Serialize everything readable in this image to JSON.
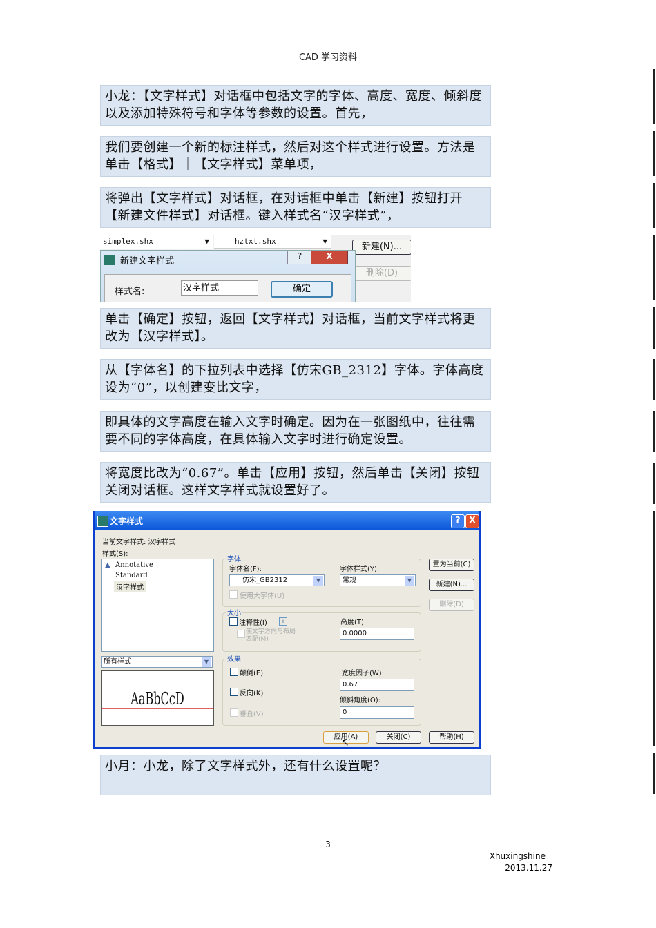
{
  "header": {
    "title": "CAD 学习资料"
  },
  "paragraphs": [
    "小龙：【文字样式】对话框中包括文字的字体、高度、宽度、倾斜度以及添加特殊符号和字体等参数的设置。首先，",
    "我们要创建一个新的标注样式，然后对这个样式进行设置。方法是单击【格式】｜【文字样式】菜单项，",
    "将弹出【文字样式】对话框，在对话框中单击【新建】按钮打开【新建文件样式】对话框。键入样式名“汉字样式”，",
    "单击【确定】按钮，返回【文字样式】对话框，当前文字样式将更改为【汉字样式】。",
    "从【字体名】的下拉列表中选择【仿宋GB_2312】字体。字体高度设为“0”，以创建变比文字，",
    "即具体的文字高度在输入文字时确定。因为在一张图纸中，往往需要不同的字体高度，在具体输入文字时进行确定设置。",
    "将宽度比改为“0.67”。单击【应用】按钮，然后单击【关闭】按钮关闭对话框。这样文字样式就设置好了。",
    "小月：小龙，除了文字样式外，还有什么设置呢？"
  ],
  "new_style_dialog": {
    "font_combo": "simplex.shx",
    "bigfont_combo": "hztxt.shx",
    "new_btn": "新建(N)...",
    "delete_btn": "删除(D)",
    "title": "新建文字样式",
    "help": "?",
    "close": "X",
    "name_label": "样式名:",
    "name_value": "汉字样式",
    "ok": "确定"
  },
  "text_style_dialog": {
    "title": "文字样式",
    "help": "?",
    "close": "X",
    "current_label": "当前文字样式:  汉字样式",
    "styles_label": "样式(S):",
    "styles": [
      "Annotative",
      "Standard",
      "汉字样式"
    ],
    "filter": "所有样式",
    "preview": "AaBbCcD",
    "font_group": "字体",
    "font_name_label": "字体名(F):",
    "font_name": "仿宋_GB2312",
    "font_style_label": "字体样式(Y):",
    "font_style": "常规",
    "bigfont": "使用大字体(U)",
    "size_group": "大小",
    "annotative": "注释性(I)",
    "info": "i",
    "match": "使文字方向与布局",
    "match2": "匹配(M)",
    "height_label": "高度(T)",
    "height": "0.0000",
    "effects_group": "效果",
    "upside": "颠倒(E)",
    "backwards": "反向(K)",
    "vertical": "垂直(V)",
    "width_label": "宽度因子(W):",
    "width": "0.67",
    "oblique_label": "倾斜角度(O):",
    "oblique": "0",
    "set_current": "置为当前(C)",
    "new": "新建(N)...",
    "delete": "删除(D)",
    "apply": "应用(A)",
    "close_btn": "关闭(C)",
    "help_btn": "帮助(H)"
  },
  "footer": {
    "page": "3",
    "author": "Xhuxingshine",
    "date": "2013.11.27"
  }
}
